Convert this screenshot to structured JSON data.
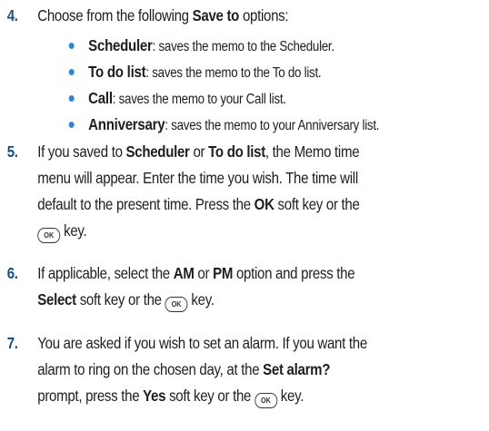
{
  "step4": {
    "number": "4.",
    "before": "Choose from the following ",
    "bold": "Save to",
    "after": " options:"
  },
  "options": [
    {
      "term": "Scheduler",
      "desc": ": saves the memo to the Scheduler."
    },
    {
      "term": "To do list",
      "desc": ": saves the memo to the To do list."
    },
    {
      "term": "Call",
      "desc": ": saves the memo to your Call list."
    },
    {
      "term": "Anniversary",
      "desc": ": saves the memo to your Anniversary list."
    }
  ],
  "step5": {
    "number": "5.",
    "l1_a": "If you saved to ",
    "l1_b": "Scheduler",
    "l1_c": " or ",
    "l1_d": "To do list",
    "l1_e": ", the Memo time",
    "l2": "menu will appear. Enter the time you wish. The time will",
    "l3_a": "default to the present time. Press the ",
    "l3_b": "OK",
    "l3_c": " soft key or the",
    "l4": " key."
  },
  "step6": {
    "number": "6.",
    "l1_a": "If applicable, select the ",
    "l1_b": "AM",
    "l1_c": " or ",
    "l1_d": "PM",
    "l1_e": " option and press the",
    "l2_a": "Select",
    "l2_b": " soft key or the ",
    "l2_c": " key."
  },
  "step7": {
    "number": "7.",
    "l1": "You are asked if you wish to set an alarm. If you want the",
    "l2_a": "alarm to ring on the chosen day, at the ",
    "l2_b": "Set alarm?",
    "l3_a": "prompt,  press the ",
    "l3_b": "Yes",
    "l3_c": " soft key or the ",
    "l3_d": " key."
  },
  "ok_key_label": "OK"
}
